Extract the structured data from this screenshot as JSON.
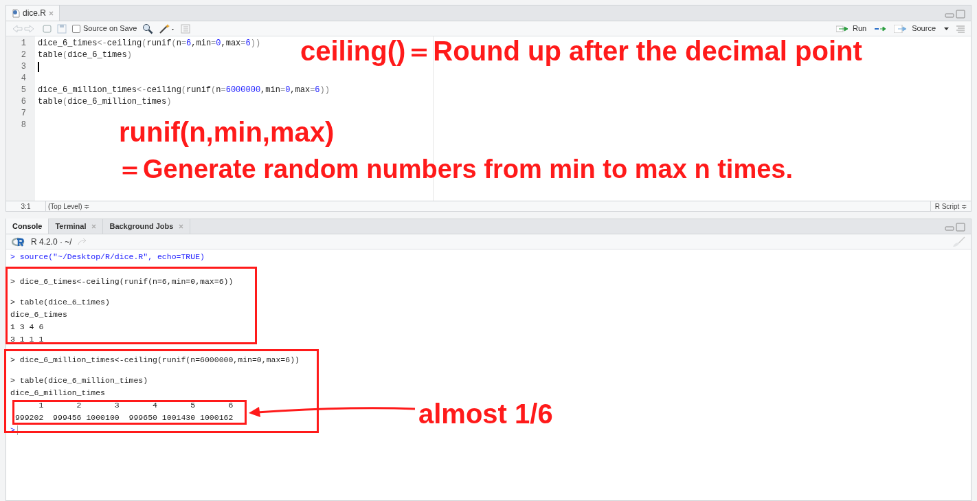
{
  "editor": {
    "tab": {
      "title": "dice.R",
      "selected": true
    },
    "toolbar": {
      "source_on_save": {
        "label": "Source on Save",
        "checked": false
      },
      "run_label": "Run",
      "source_label": "Source"
    },
    "lines": [
      {
        "number": "1",
        "text": "dice_6_times<-ceiling(runif(n=6,min=0,max=6))",
        "cursor": false
      },
      {
        "number": "2",
        "text": "table(dice_6_times)",
        "cursor": false
      },
      {
        "number": "3",
        "cursor": true
      },
      {
        "number": "4",
        "cursor": false
      },
      {
        "number": "5",
        "text": "dice_6_million_times<-ceiling(runif(n=6000000,min=0,max=6))",
        "cursor": false
      },
      {
        "number": "6",
        "text": "table(dice_6_million_times)",
        "cursor": false
      },
      {
        "number": "7",
        "cursor": false
      },
      {
        "number": "8",
        "cursor": false
      }
    ],
    "status": {
      "position": "3:1",
      "scope": "(Top Level) ≑",
      "file_type": "R Script ≑"
    }
  },
  "console": {
    "tabs": [
      {
        "label": "Console",
        "selected": true
      },
      {
        "label": "Terminal",
        "selected": false
      },
      {
        "label": "Background Jobs",
        "selected": false
      }
    ],
    "version": "R 4.2.0 · ~/",
    "lines": [
      {
        "kind": "source",
        "text": "> source(\"~/Desktop/R/dice.R\", echo=TRUE)"
      },
      {
        "kind": "command",
        "text": "> dice_6_times<-ceiling(runif(n=6,min=0,max=6))"
      },
      {
        "kind": "command",
        "text": "> table(dice_6_times)"
      },
      {
        "kind": "output",
        "text": "dice_6_times"
      },
      {
        "kind": "output",
        "text": "1 3 4 6 "
      },
      {
        "kind": "output",
        "text": "3 1 1 1 "
      },
      {
        "kind": "command",
        "text": "> dice_6_million_times<-ceiling(runif(n=6000000,min=0,max=6))"
      },
      {
        "kind": "command",
        "text": "> table(dice_6_million_times)"
      },
      {
        "kind": "output",
        "text": "dice_6_million_times"
      },
      {
        "kind": "output",
        "text": "      1       2       3       4       5       6 "
      },
      {
        "kind": "output",
        "text": " 999202  999456 1000100  999650 1001430 1000162 "
      },
      {
        "kind": "prompt",
        "text": ">"
      }
    ]
  },
  "annotations": [
    {
      "text": "ceiling()＝Round up after the decimal point"
    },
    {
      "text": "runif(n,min,max)"
    },
    {
      "text": "＝Generate random numbers from min to max n times."
    },
    {
      "text": "almost 1/6"
    }
  ]
}
